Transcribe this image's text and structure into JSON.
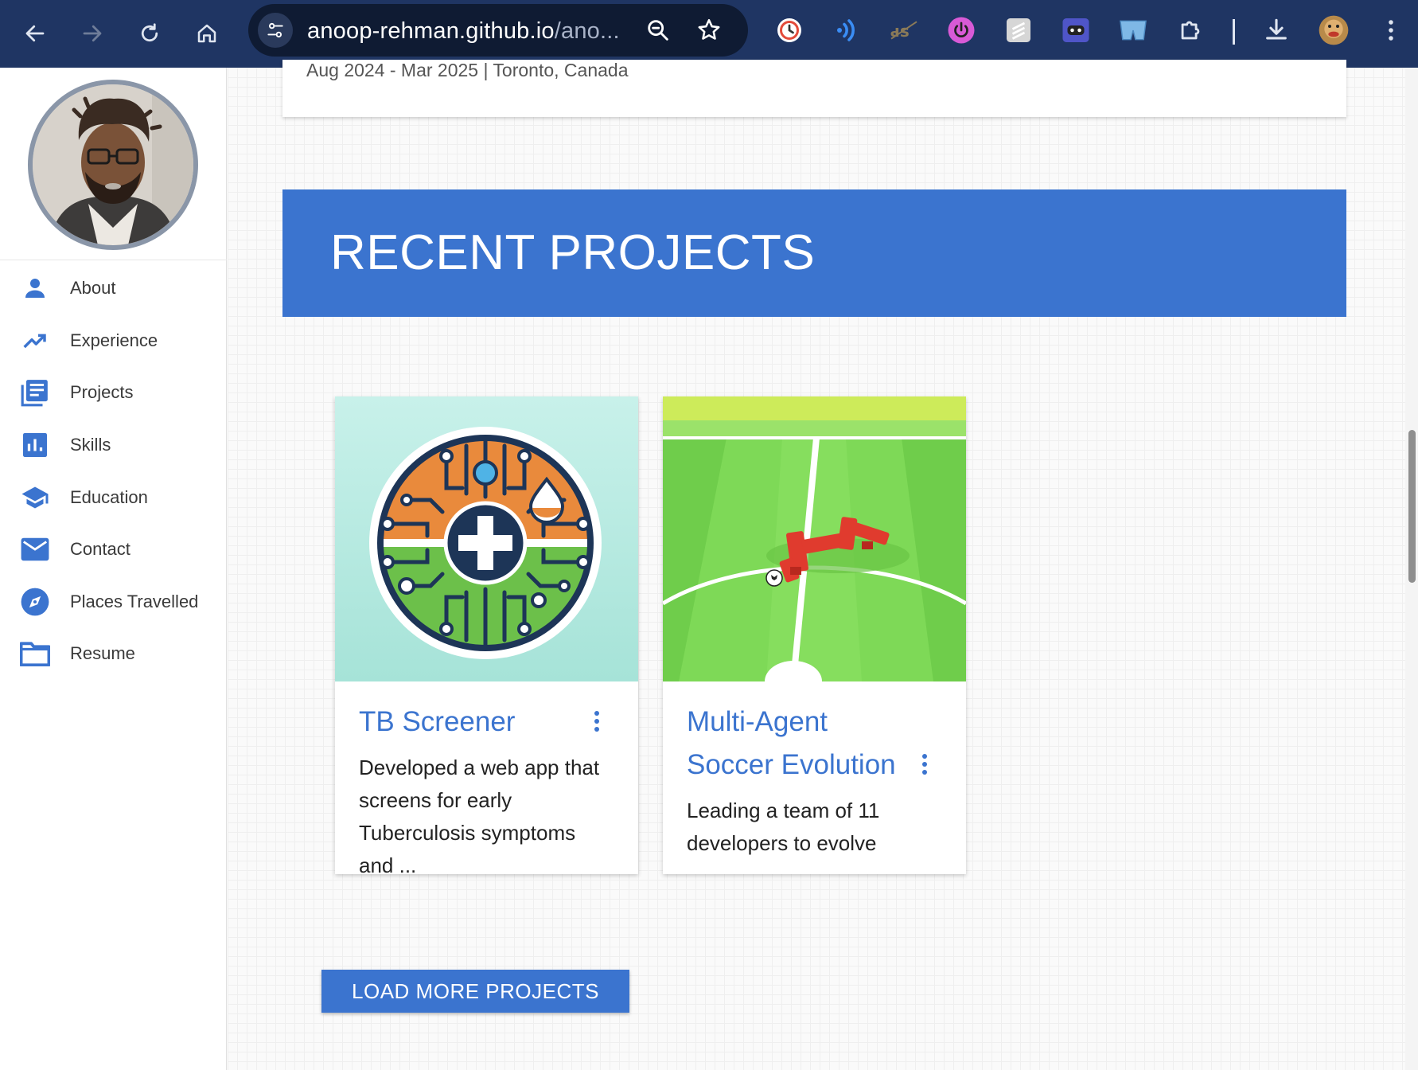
{
  "browser": {
    "url_host": "anoop-rehman.github.io",
    "url_path": "/ano..."
  },
  "sidebar": {
    "items": [
      {
        "label": "About",
        "icon": "person-icon"
      },
      {
        "label": "Experience",
        "icon": "trending-up-icon"
      },
      {
        "label": "Projects",
        "icon": "article-icon"
      },
      {
        "label": "Skills",
        "icon": "bar-chart-icon"
      },
      {
        "label": "Education",
        "icon": "graduation-cap-icon"
      },
      {
        "label": "Contact",
        "icon": "mail-icon"
      },
      {
        "label": "Places Travelled",
        "icon": "compass-icon"
      },
      {
        "label": "Resume",
        "icon": "folder-icon"
      }
    ]
  },
  "experience": {
    "meta": "Aug 2024 - Mar 2025 | Toronto, Canada"
  },
  "projects": {
    "heading": "RECENT PROJECTS",
    "cards": [
      {
        "title": "TB Screener",
        "description": "Developed a web app that screens for early Tuberculosis symptoms and ..."
      },
      {
        "title": "Multi-Agent Soccer Evolution",
        "description": "Leading a team of 11 developers to evolve"
      }
    ],
    "load_more": "LOAD MORE PROJECTS"
  },
  "colors": {
    "accent": "#3b74cf",
    "chrome": "#1f3563"
  }
}
